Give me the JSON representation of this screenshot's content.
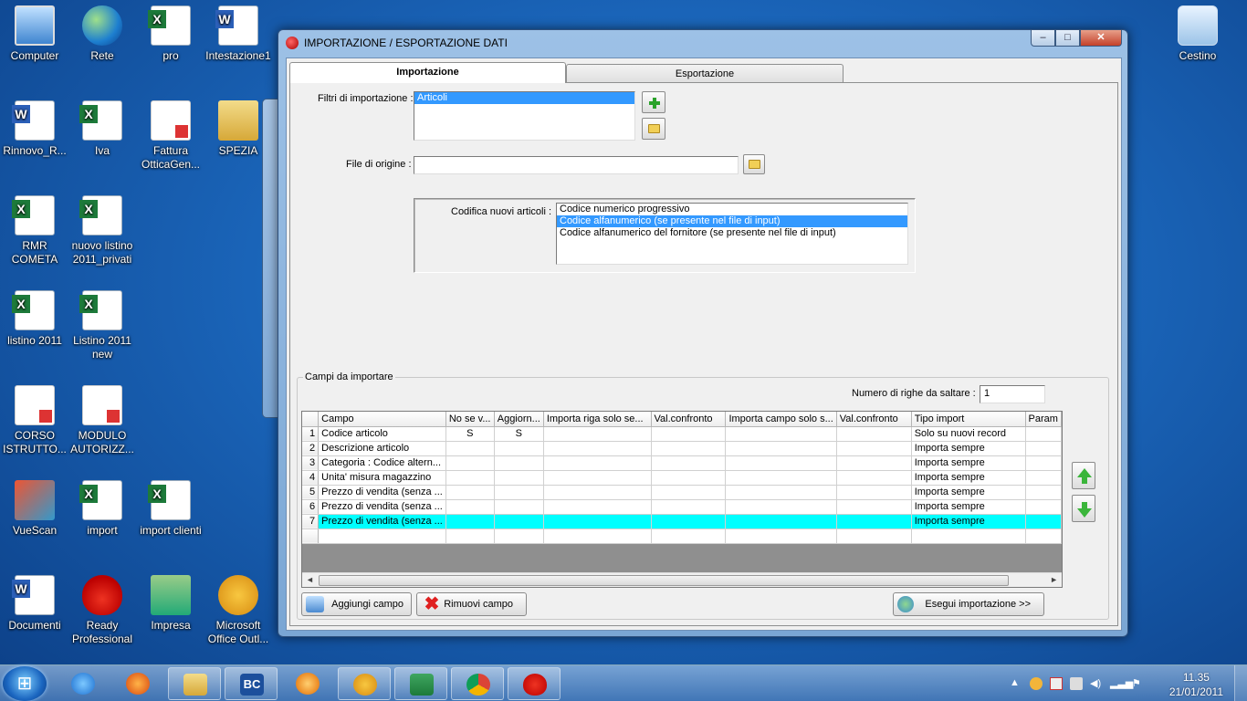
{
  "desktop_icons": [
    {
      "label": "Computer",
      "icon": "computer-icon"
    },
    {
      "label": "Rete",
      "icon": "network-icon"
    },
    {
      "label": "pro",
      "icon": "excel-file-icon"
    },
    {
      "label": "Intestazione1",
      "icon": "word-file-icon"
    },
    {
      "label": "Rinnovo_R...",
      "icon": "word-file-icon"
    },
    {
      "label": "Iva",
      "icon": "excel-file-icon"
    },
    {
      "label": "Fattura OtticaGen...",
      "icon": "pdf-file-icon"
    },
    {
      "label": "SPEZIA",
      "icon": "folder-icon"
    },
    {
      "label": "RMR COMETA",
      "icon": "excel-file-icon"
    },
    {
      "label": "nuovo listino 2011_privati",
      "icon": "ods-file-icon"
    },
    {
      "label": "listino 2011",
      "icon": "excel-file-icon"
    },
    {
      "label": "Listino 2011 new",
      "icon": "excel-file-icon"
    },
    {
      "label": "CORSO ISTRUTTO...",
      "icon": "pdf-file-icon"
    },
    {
      "label": "MODULO AUTORIZZ...",
      "icon": "pdf-file-icon"
    },
    {
      "label": "VueScan",
      "icon": "scanner-icon"
    },
    {
      "label": "import",
      "icon": "excel-file-icon"
    },
    {
      "label": "import clienti",
      "icon": "excel-file-icon"
    },
    {
      "label": "Documenti",
      "icon": "documents-shortcut-icon"
    },
    {
      "label": "Ready Professional",
      "icon": "strawberry-icon"
    },
    {
      "label": "Impresa",
      "icon": "impresa-icon"
    },
    {
      "label": "Microsoft Office Outl...",
      "icon": "outlook-icon"
    },
    {
      "label": "Cestino",
      "icon": "recycle-bin-icon"
    }
  ],
  "window": {
    "title": "IMPORTAZIONE / ESPORTAZIONE DATI",
    "minimize": "–",
    "maximize": "□",
    "close": "✕"
  },
  "tabs": [
    {
      "label": "Importazione",
      "active": true
    },
    {
      "label": "Esportazione",
      "active": false
    }
  ],
  "import": {
    "filters_label": "Filtri di importazione :",
    "filters": [
      "Articoli"
    ],
    "source_file_label": "File di origine :",
    "source_file_value": "",
    "codifica_label": "Codifica nuovi articoli :",
    "codifica_options": [
      {
        "label": "Codice numerico progressivo",
        "selected": false
      },
      {
        "label": "Codice alfanumerico (se presente nel file di input)",
        "selected": true
      },
      {
        "label": "Codice alfanumerico del fornitore (se presente nel file di input)",
        "selected": false
      }
    ],
    "fields_group_label": "Campi da importare",
    "skip_rows_label": "Numero di righe da saltare  :",
    "skip_rows_value": "1",
    "grid": {
      "columns": [
        "Campo",
        "No se v...",
        "Aggiorn...",
        "Importa riga solo se...",
        "Val.confronto",
        "Importa campo solo s...",
        "Val.confronto",
        "Tipo import",
        "Param"
      ],
      "rows": [
        {
          "n": "1",
          "campo": "Codice articolo",
          "no_se": "S",
          "aggiorn": "S",
          "tipo": "Solo su nuovi record",
          "highlight": false
        },
        {
          "n": "2",
          "campo": "Descrizione articolo",
          "no_se": "",
          "aggiorn": "",
          "tipo": "Importa sempre",
          "highlight": false
        },
        {
          "n": "3",
          "campo": "Categoria : Codice altern...",
          "no_se": "",
          "aggiorn": "",
          "tipo": "Importa sempre",
          "highlight": false
        },
        {
          "n": "4",
          "campo": "Unita' misura magazzino",
          "no_se": "",
          "aggiorn": "",
          "tipo": "Importa sempre",
          "highlight": false
        },
        {
          "n": "5",
          "campo": "Prezzo di vendita (senza ...",
          "no_se": "",
          "aggiorn": "",
          "tipo": "Importa sempre",
          "highlight": false
        },
        {
          "n": "6",
          "campo": "Prezzo di vendita (senza ...",
          "no_se": "",
          "aggiorn": "",
          "tipo": "Importa sempre",
          "highlight": false
        },
        {
          "n": "7",
          "campo": "Prezzo di vendita (senza ...",
          "no_se": "",
          "aggiorn": "",
          "tipo": "Importa sempre",
          "highlight": true
        }
      ],
      "highlight_color": "#00ffff"
    },
    "add_field_button": "Aggiungi campo",
    "remove_field_button": "Rimuovi campo",
    "run_import_button": "Esegui importazione >>"
  },
  "taskbar": {
    "pinned": [
      "internet-explorer-icon",
      "firefox-icon",
      "explorer-icon",
      "bc-icon",
      "media-player-icon",
      "outlook-icon",
      "excel-icon",
      "chrome-icon",
      "strawberry-icon"
    ],
    "bc_label": "BC",
    "clock_time": "11.35",
    "clock_date": "21/01/2011"
  }
}
